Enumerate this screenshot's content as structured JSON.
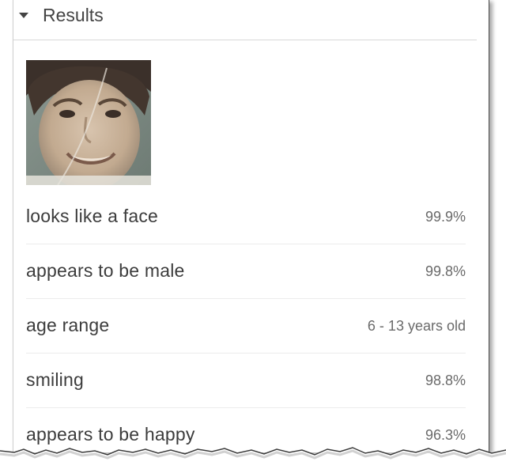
{
  "panel": {
    "title": "Results",
    "thumbnail": {
      "icon": "face-photo",
      "colors": {
        "background": "#7d8a84",
        "skin": "#c9b39b",
        "hair": "#3b302a"
      }
    }
  },
  "results": [
    {
      "label": "looks like a face",
      "value": "99.9%"
    },
    {
      "label": "appears to be male",
      "value": "99.8%"
    },
    {
      "label": "age range",
      "value": "6 - 13 years old"
    },
    {
      "label": "smiling",
      "value": "98.8%"
    },
    {
      "label": "appears to be happy",
      "value": "96.3%"
    }
  ]
}
